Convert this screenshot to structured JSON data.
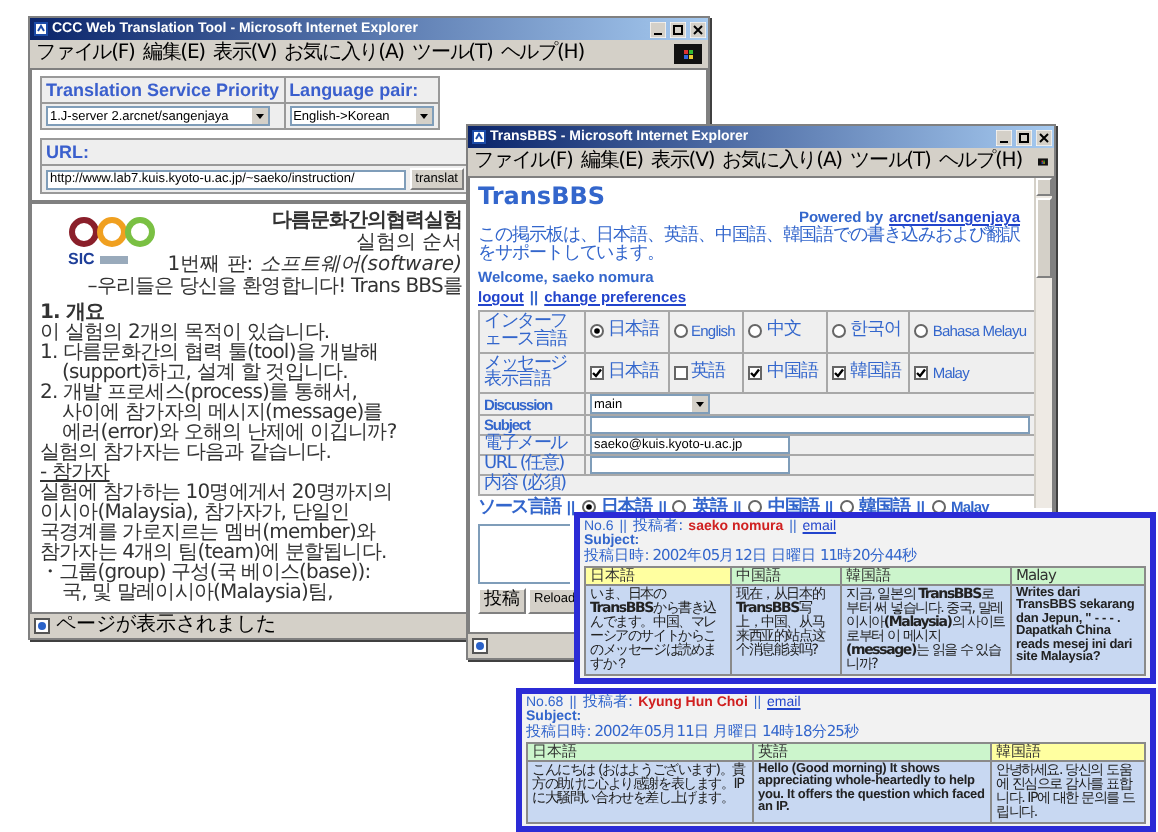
{
  "tool_window": {
    "title": "CCC Web Translation Tool - Microsoft Internet Explorer",
    "menu": [
      "ファイル(F)",
      "編集(E)",
      "表示(V)",
      "お気に入り(A)",
      "ツール(T)",
      "ヘルプ(H)"
    ],
    "priority": {
      "label": "Translation Service Priority",
      "value": "1.J-server 2.arcnet/sangenjaya"
    },
    "language_pair": {
      "label": "Language pair:",
      "value": "English->Korean"
    },
    "url": {
      "label": "URL:",
      "value": "http://www.lab7.kuis.kyoto-u.ac.jp/~saeko/instruction/",
      "button": "translat"
    },
    "logo": {
      "text": "SIC"
    },
    "document": {
      "title": "다름문화간의협력실험",
      "subtitles": [
        "실험의 순서",
        "1번째 판: *소프트웨어(software)*"
      ],
      "lines": [
        {
          "kind": "lead",
          "text": "–우리들은 당신을 환영합니다! Trans BBS를"
        },
        {
          "kind": "heading",
          "text": "1. 개요"
        },
        {
          "kind": "para",
          "text": "이 실험의 2개의 목적이 있습니다."
        },
        {
          "kind": "item",
          "text": "1. 다름문화간의 협력 툴(tool)을 개발해"
        },
        {
          "kind": "continued",
          "text": "(support)하고, 설계 할 것입니다."
        },
        {
          "kind": "item",
          "text": "2. 개발 프로세스(process)를 통해서,"
        },
        {
          "kind": "continued",
          "text": "사이에 참가자의 메시지(message)를"
        },
        {
          "kind": "continued",
          "text": "에러(error)와 오해의 난제에 이깁니까?"
        },
        {
          "kind": "para",
          "text": "실험의 참가자는 다음과 같습니다."
        },
        {
          "kind": "underlined",
          "text": "- 참가자"
        },
        {
          "kind": "para",
          "text": "실험에 참가하는 10명에게서 20명까지의"
        },
        {
          "kind": "para",
          "text": "이시아(Malaysia), 참가자가, 단일인"
        },
        {
          "kind": "para",
          "text": "국경계를 가로지르는 멤버(member)와"
        },
        {
          "kind": "para",
          "text": "참가자는 4개의 팀(team)에 분할됩니다."
        },
        {
          "kind": "item",
          "text": "・그룹(group) 구성(국 베이스(base)):"
        },
        {
          "kind": "continued",
          "text": "국, 및 말레이시아(Malaysia)팀,"
        }
      ]
    },
    "status": "ページが表示されました"
  },
  "bbs_window": {
    "title": "TransBBS - Microsoft Internet Explorer",
    "menu": [
      "ファイル(F)",
      "編集(E)",
      "表示(V)",
      "お気に入り(A)",
      "ツール(T)",
      "ヘルプ(H)"
    ],
    "heading": "TransBBS",
    "powered": {
      "text": "Powered by",
      "link": "arcnet/sangenjaya"
    },
    "intro": "この掲示板は、日本語、英語、中国語、韓国語での書き込みおよび翻訳をサポートしています。",
    "welcome": "Welcome, saeko nomura",
    "links": {
      "items": [
        "logout",
        "change preferences"
      ],
      "separator": "||"
    },
    "settings": [
      {
        "label": "インターフェース言語",
        "kind": "radio",
        "options": [
          {
            "label": "日本語",
            "selected": true
          },
          {
            "label": "English",
            "selected": false
          },
          {
            "label": "中文",
            "selected": false
          },
          {
            "label": "한국어",
            "selected": false
          },
          {
            "label": "Bahasa Melayu",
            "selected": false
          }
        ]
      },
      {
        "label": "メッセージ表示言語",
        "kind": "checkbox",
        "options": [
          {
            "label": "日本語",
            "checked": true
          },
          {
            "label": "英語",
            "checked": false
          },
          {
            "label": "中国語",
            "checked": true
          },
          {
            "label": "韓国語",
            "checked": true
          },
          {
            "label": "Malay",
            "checked": true
          }
        ]
      }
    ],
    "form": [
      {
        "kind": "select",
        "label": "Discussion",
        "value": "main"
      },
      {
        "kind": "input",
        "label": "Subject"
      },
      {
        "kind": "input",
        "label": "電子メール",
        "value": "saeko@kuis.kyoto-u.ac.jp"
      },
      {
        "kind": "input",
        "label": "URL (任意)"
      }
    ],
    "content": {
      "label": "内容 (必須)",
      "source_label": "ソース言語",
      "separator": "||",
      "options": [
        {
          "label": "日本語",
          "selected": true
        },
        {
          "label": "英語",
          "selected": false
        },
        {
          "label": "中国語",
          "selected": false
        },
        {
          "label": "韓国語",
          "selected": false
        },
        {
          "label": "Malay",
          "selected": false
        }
      ]
    },
    "buttons": [
      "投稿",
      "Reload"
    ]
  },
  "posts": [
    {
      "number": "No.6",
      "separator": "||",
      "author_label": "投稿者:",
      "author": "saeko nomura",
      "email": "email",
      "subject": "Subject:",
      "date": "投稿日時: 2002年05月12日 日曜日 11時20分44秒",
      "columns": [
        {
          "language": "日本語",
          "source": true,
          "bold": false,
          "text": "いま、日本の**TransBBS**から書き込んでます。中国、マレーシアのサイトからこのメッセージは読めますか？"
        },
        {
          "language": "中国語",
          "source": false,
          "bold": false,
          "text": "现在，从日本的**TransBBS**写上，中国、从马来西亚的站点这个消息能读吗?"
        },
        {
          "language": "韓国語",
          "source": false,
          "bold": false,
          "text": "지금, 일본의 **TransBBS**로부터 써 넣습니다. 중국, 말레이시아**(Malaysia)**의 사이트로부터 이 메시지**(message)**는 읽을 수 있습니까?"
        },
        {
          "language": "Malay",
          "source": false,
          "bold": true,
          "text": "Writes dari TransBBS sekarang dan Jepun, \" - - - . Dapatkah China reads mesej ini dari site Malaysia?"
        }
      ]
    },
    {
      "number": "No.68",
      "separator": "||",
      "author_label": "投稿者:",
      "author": "Kyung Hun Choi",
      "email": "email",
      "subject": "Subject:",
      "date": "投稿日時: 2002年05月11日 月曜日 14時18分25秒",
      "columns": [
        {
          "language": "日本語",
          "source": false,
          "bold": false,
          "text": "こんにちは (おはようございます)。貴方の助けに心より感謝を表します。IPに大騒問い合わせを差し上げます。"
        },
        {
          "language": "英語",
          "source": false,
          "bold": true,
          "text": "Hello (Good morning) It shows appreciating whole-heartedly to help you. It offers the question which faced an IP."
        },
        {
          "language": "韓国語",
          "source": true,
          "bold": false,
          "text": "안녕하세요. 당신의 도움에 진심으로 감사를 표합니다. IP에 대한 문의를 드립니다."
        }
      ]
    }
  ]
}
